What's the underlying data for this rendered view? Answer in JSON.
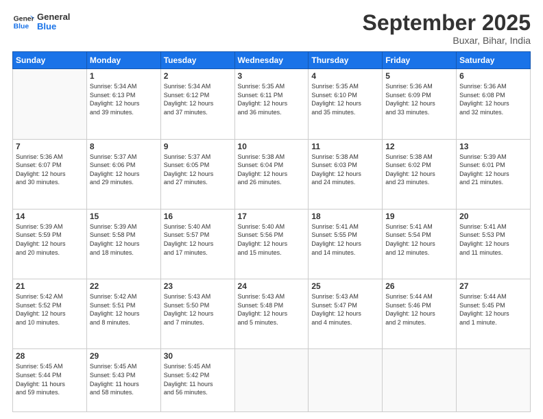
{
  "header": {
    "logo_general": "General",
    "logo_blue": "Blue",
    "month_title": "September 2025",
    "subtitle": "Buxar, Bihar, India"
  },
  "weekdays": [
    "Sunday",
    "Monday",
    "Tuesday",
    "Wednesday",
    "Thursday",
    "Friday",
    "Saturday"
  ],
  "weeks": [
    [
      {
        "day": "",
        "info": ""
      },
      {
        "day": "1",
        "info": "Sunrise: 5:34 AM\nSunset: 6:13 PM\nDaylight: 12 hours\nand 39 minutes."
      },
      {
        "day": "2",
        "info": "Sunrise: 5:34 AM\nSunset: 6:12 PM\nDaylight: 12 hours\nand 37 minutes."
      },
      {
        "day": "3",
        "info": "Sunrise: 5:35 AM\nSunset: 6:11 PM\nDaylight: 12 hours\nand 36 minutes."
      },
      {
        "day": "4",
        "info": "Sunrise: 5:35 AM\nSunset: 6:10 PM\nDaylight: 12 hours\nand 35 minutes."
      },
      {
        "day": "5",
        "info": "Sunrise: 5:36 AM\nSunset: 6:09 PM\nDaylight: 12 hours\nand 33 minutes."
      },
      {
        "day": "6",
        "info": "Sunrise: 5:36 AM\nSunset: 6:08 PM\nDaylight: 12 hours\nand 32 minutes."
      }
    ],
    [
      {
        "day": "7",
        "info": "Sunrise: 5:36 AM\nSunset: 6:07 PM\nDaylight: 12 hours\nand 30 minutes."
      },
      {
        "day": "8",
        "info": "Sunrise: 5:37 AM\nSunset: 6:06 PM\nDaylight: 12 hours\nand 29 minutes."
      },
      {
        "day": "9",
        "info": "Sunrise: 5:37 AM\nSunset: 6:05 PM\nDaylight: 12 hours\nand 27 minutes."
      },
      {
        "day": "10",
        "info": "Sunrise: 5:38 AM\nSunset: 6:04 PM\nDaylight: 12 hours\nand 26 minutes."
      },
      {
        "day": "11",
        "info": "Sunrise: 5:38 AM\nSunset: 6:03 PM\nDaylight: 12 hours\nand 24 minutes."
      },
      {
        "day": "12",
        "info": "Sunrise: 5:38 AM\nSunset: 6:02 PM\nDaylight: 12 hours\nand 23 minutes."
      },
      {
        "day": "13",
        "info": "Sunrise: 5:39 AM\nSunset: 6:01 PM\nDaylight: 12 hours\nand 21 minutes."
      }
    ],
    [
      {
        "day": "14",
        "info": "Sunrise: 5:39 AM\nSunset: 5:59 PM\nDaylight: 12 hours\nand 20 minutes."
      },
      {
        "day": "15",
        "info": "Sunrise: 5:39 AM\nSunset: 5:58 PM\nDaylight: 12 hours\nand 18 minutes."
      },
      {
        "day": "16",
        "info": "Sunrise: 5:40 AM\nSunset: 5:57 PM\nDaylight: 12 hours\nand 17 minutes."
      },
      {
        "day": "17",
        "info": "Sunrise: 5:40 AM\nSunset: 5:56 PM\nDaylight: 12 hours\nand 15 minutes."
      },
      {
        "day": "18",
        "info": "Sunrise: 5:41 AM\nSunset: 5:55 PM\nDaylight: 12 hours\nand 14 minutes."
      },
      {
        "day": "19",
        "info": "Sunrise: 5:41 AM\nSunset: 5:54 PM\nDaylight: 12 hours\nand 12 minutes."
      },
      {
        "day": "20",
        "info": "Sunrise: 5:41 AM\nSunset: 5:53 PM\nDaylight: 12 hours\nand 11 minutes."
      }
    ],
    [
      {
        "day": "21",
        "info": "Sunrise: 5:42 AM\nSunset: 5:52 PM\nDaylight: 12 hours\nand 10 minutes."
      },
      {
        "day": "22",
        "info": "Sunrise: 5:42 AM\nSunset: 5:51 PM\nDaylight: 12 hours\nand 8 minutes."
      },
      {
        "day": "23",
        "info": "Sunrise: 5:43 AM\nSunset: 5:50 PM\nDaylight: 12 hours\nand 7 minutes."
      },
      {
        "day": "24",
        "info": "Sunrise: 5:43 AM\nSunset: 5:48 PM\nDaylight: 12 hours\nand 5 minutes."
      },
      {
        "day": "25",
        "info": "Sunrise: 5:43 AM\nSunset: 5:47 PM\nDaylight: 12 hours\nand 4 minutes."
      },
      {
        "day": "26",
        "info": "Sunrise: 5:44 AM\nSunset: 5:46 PM\nDaylight: 12 hours\nand 2 minutes."
      },
      {
        "day": "27",
        "info": "Sunrise: 5:44 AM\nSunset: 5:45 PM\nDaylight: 12 hours\nand 1 minute."
      }
    ],
    [
      {
        "day": "28",
        "info": "Sunrise: 5:45 AM\nSunset: 5:44 PM\nDaylight: 11 hours\nand 59 minutes."
      },
      {
        "day": "29",
        "info": "Sunrise: 5:45 AM\nSunset: 5:43 PM\nDaylight: 11 hours\nand 58 minutes."
      },
      {
        "day": "30",
        "info": "Sunrise: 5:45 AM\nSunset: 5:42 PM\nDaylight: 11 hours\nand 56 minutes."
      },
      {
        "day": "",
        "info": ""
      },
      {
        "day": "",
        "info": ""
      },
      {
        "day": "",
        "info": ""
      },
      {
        "day": "",
        "info": ""
      }
    ]
  ]
}
